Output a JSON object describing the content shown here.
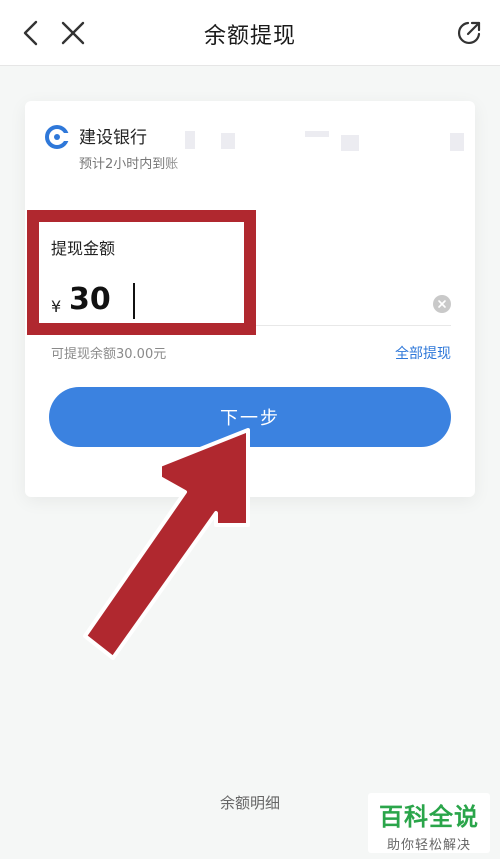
{
  "header": {
    "title": "余额提现",
    "back_icon": "back-arrow-icon",
    "close_icon": "close-icon",
    "share_icon": "share-icon"
  },
  "bank": {
    "name": "建设银行",
    "eta": "预计2小时内到账",
    "icon": "ccb-bank-logo",
    "brand_color": "#2f78d9"
  },
  "amount": {
    "label": "提现金额",
    "currency": "¥",
    "value": "30",
    "clear_icon": "clear-circle-icon"
  },
  "balance": {
    "text": "可提现余额30.00元",
    "withdraw_all": "全部提现"
  },
  "next_button": {
    "label": "下一步",
    "color": "#3b82e0"
  },
  "footer": {
    "balance_detail": "余额明细"
  },
  "annotation": {
    "color": "#b0282f"
  },
  "watermark": {
    "title": "百科全说",
    "subtitle": "助你轻松解决",
    "color": "#2aa54a"
  }
}
